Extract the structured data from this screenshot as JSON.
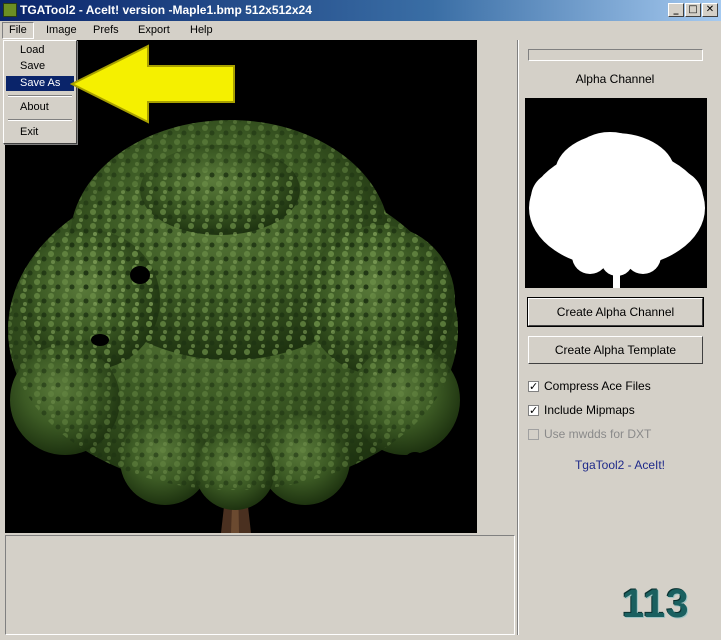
{
  "window": {
    "title": "TGATool2 - AceIt! version -Maple1.bmp  512x512x24",
    "minimize": "_",
    "maximize": "□",
    "close": "✕"
  },
  "menu": [
    {
      "label": "File"
    },
    {
      "label": "Image"
    },
    {
      "label": "Prefs"
    },
    {
      "label": "Export"
    },
    {
      "label": "Help"
    }
  ],
  "file_menu": {
    "items": [
      "Load",
      "Save",
      "Save As",
      "About",
      "Exit"
    ],
    "highlighted": "Save As"
  },
  "right_panel": {
    "alpha_label": "Alpha Channel",
    "create_alpha_channel": "Create Alpha Channel",
    "create_alpha_template": "Create Alpha Template",
    "options": [
      {
        "label": "Compress Ace Files",
        "checked": true,
        "enabled": true
      },
      {
        "label": "Include Mipmaps",
        "checked": true,
        "enabled": true
      },
      {
        "label": "Use mwdds for DXT",
        "checked": false,
        "enabled": false
      }
    ],
    "brand": "TgaTool2 - AceIt!"
  },
  "page_number": "113",
  "colors": {
    "highlight": "#0a246a",
    "arrow": "#f5f000",
    "tree": "#2f4f1f",
    "page_number": "#1a6060"
  },
  "icons": {
    "app": "tga-app-icon",
    "pointer": "yellow-arrow-icon"
  }
}
